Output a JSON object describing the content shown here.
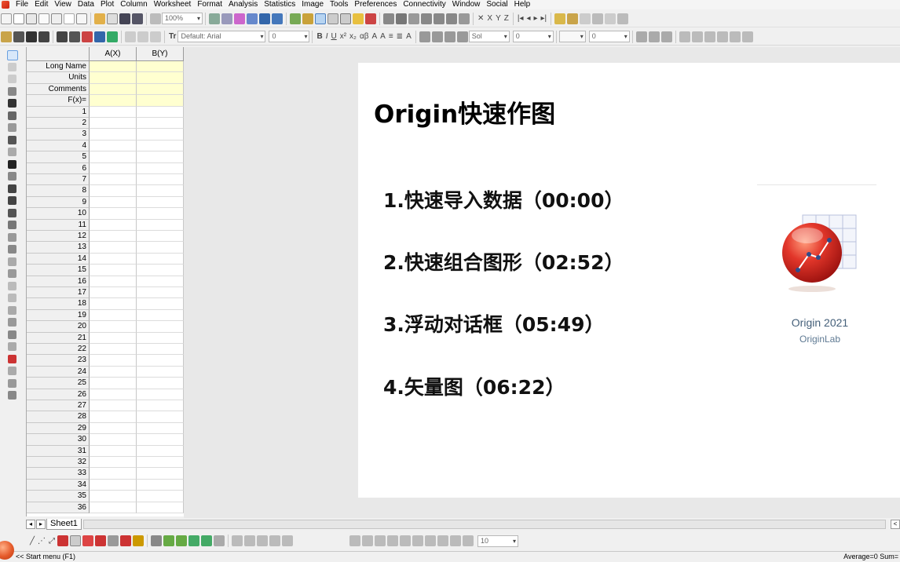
{
  "menubar": {
    "items": [
      "File",
      "Edit",
      "View",
      "Data",
      "Plot",
      "Column",
      "Worksheet",
      "Format",
      "Analysis",
      "Statistics",
      "Image",
      "Tools",
      "Preferences",
      "Connectivity",
      "Window",
      "Social",
      "Help"
    ]
  },
  "toolbar": {
    "zoom": "100%",
    "font": "Default: Arial",
    "font_size": "0",
    "line_style": "Sol",
    "line_width": "0",
    "fill_value": "0",
    "bottom_size": "10"
  },
  "worksheet": {
    "columns": [
      "A(X)",
      "B(Y)"
    ],
    "label_rows": [
      "Long Name",
      "Units",
      "Comments",
      "F(x)="
    ],
    "row_numbers": [
      "1",
      "2",
      "3",
      "4",
      "5",
      "6",
      "7",
      "8",
      "9",
      "10",
      "11",
      "12",
      "13",
      "14",
      "15",
      "16",
      "17",
      "18",
      "19",
      "20",
      "21",
      "22",
      "23",
      "24",
      "25",
      "26",
      "27",
      "28",
      "29",
      "30",
      "31",
      "32",
      "33",
      "34",
      "35",
      "36"
    ]
  },
  "sheet_tab": "Sheet1",
  "slide": {
    "title": "Origin快速作图",
    "items": [
      "1.快速导入数据（00:00）",
      "2.快速组合图形（02:52）",
      "3.浮动对话框（05:49）",
      "4.矢量图（06:22）"
    ],
    "logo_name": "Origin 2021",
    "logo_sub": "OriginLab"
  },
  "status": {
    "start_menu": "<< Start menu (F1)",
    "summary": "Average=0 Sum="
  }
}
